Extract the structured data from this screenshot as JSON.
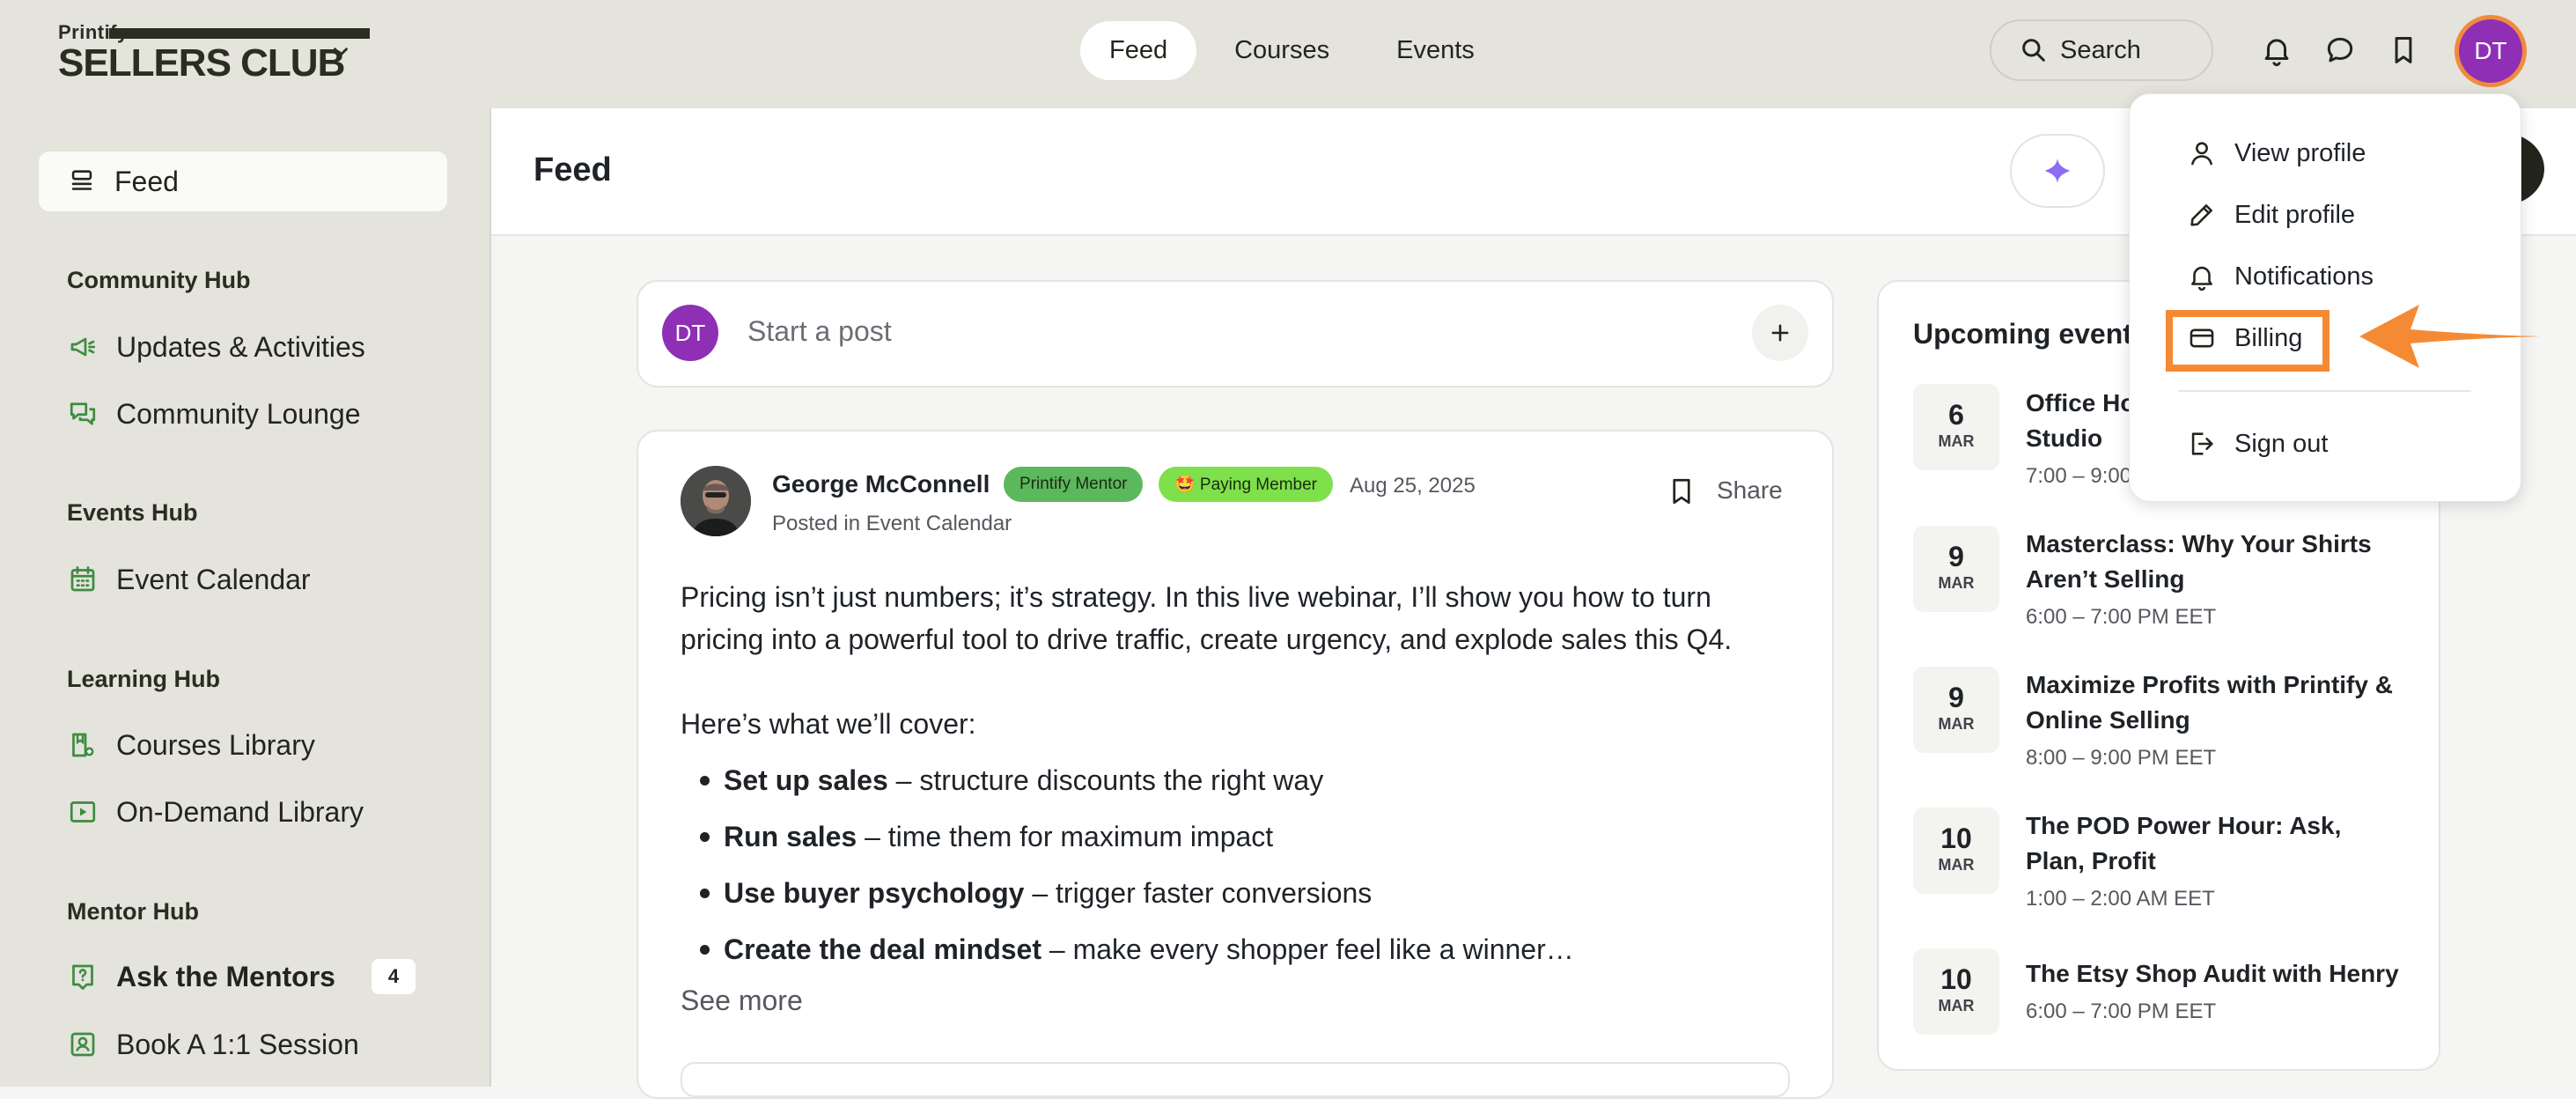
{
  "brand": {
    "small_text": "Printify",
    "big_text": "SELLERS CLUB"
  },
  "nav": {
    "tabs": [
      {
        "label": "Feed"
      },
      {
        "label": "Courses"
      },
      {
        "label": "Events"
      }
    ]
  },
  "search": {
    "label": "Search"
  },
  "user": {
    "initials": "DT"
  },
  "sidebar": {
    "feed_label": "Feed",
    "sections": [
      {
        "heading": "Community Hub",
        "items": [
          {
            "label": "Updates & Activities",
            "icon": "megaphone-icon"
          },
          {
            "label": "Community Lounge",
            "icon": "chat-bubbles-icon"
          }
        ]
      },
      {
        "heading": "Events Hub",
        "items": [
          {
            "label": "Event Calendar",
            "icon": "calendar-icon"
          }
        ]
      },
      {
        "heading": "Learning Hub",
        "items": [
          {
            "label": "Courses Library",
            "icon": "book-icon"
          },
          {
            "label": "On-Demand Library",
            "icon": "play-icon"
          }
        ]
      },
      {
        "heading": "Mentor Hub",
        "items": [
          {
            "label": "Ask the Mentors",
            "icon": "question-icon",
            "count": "4"
          },
          {
            "label": "Book A 1:1 Session",
            "icon": "person-badge-icon"
          }
        ]
      }
    ]
  },
  "main": {
    "title": "Feed"
  },
  "composer": {
    "placeholder": "Start a post"
  },
  "post": {
    "author": "George McConnell",
    "badge_mentor": "Printify Mentor",
    "badge_member": "🤩 Paying Member",
    "date": "Aug 25, 2025",
    "posted_in": "Posted in Event Calendar",
    "share_label": "Share",
    "paragraph": "Pricing isn’t just numbers; it’s strategy. In this live webinar, I’ll show you how to turn pricing into a powerful tool to drive traffic, create urgency, and explode sales this Q4.",
    "intro": "Here’s what we’ll cover:",
    "bullets": [
      {
        "bold": "Set up sales",
        "rest": " – structure discounts the right way"
      },
      {
        "bold": "Run sales",
        "rest": " – time them for maximum impact"
      },
      {
        "bold": "Use buyer psychology",
        "rest": " – trigger faster conversions"
      },
      {
        "bold": "Create the deal mindset",
        "rest": " – make every shopper feel like a winner…"
      }
    ],
    "see_more": "See more"
  },
  "events": {
    "title": "Upcoming event",
    "items": [
      {
        "day": "6",
        "month": "MAR",
        "title": "Office Ho… Studio",
        "title_line1": "Office Ho",
        "title_line2": "Studio",
        "time": "7:00 – 9:00"
      },
      {
        "day": "9",
        "month": "MAR",
        "title_line1": "Masterclass: Why Your Shirts",
        "title_line2": "Aren’t Selling",
        "time": "6:00 – 7:00 PM EET"
      },
      {
        "day": "9",
        "month": "MAR",
        "title_line1": "Maximize Profits with Printify &",
        "title_line2": "Online Selling",
        "time": "8:00 – 9:00 PM EET"
      },
      {
        "day": "10",
        "month": "MAR",
        "title_line1": "The POD Power Hour: Ask,",
        "title_line2": "Plan, Profit",
        "time": "1:00 – 2:00 AM EET"
      },
      {
        "day": "10",
        "month": "MAR",
        "title_line1": "The Etsy Shop Audit with Henry",
        "title_line2": "",
        "time": "6:00 – 7:00 PM EET"
      }
    ]
  },
  "dropdown": {
    "items": [
      {
        "label": "View profile",
        "icon": "user-icon"
      },
      {
        "label": "Edit profile",
        "icon": "pencil-icon"
      },
      {
        "label": "Notifications",
        "icon": "bell-icon"
      },
      {
        "label": "Billing",
        "icon": "credit-card-icon"
      },
      {
        "label": "Sign out",
        "icon": "sign-out-icon"
      }
    ]
  },
  "colors": {
    "accent_orange": "#f58a35",
    "avatar_purple": "#8e2fb6",
    "mentor_badge": "#5cb85c",
    "member_badge": "#7ee04a",
    "topbar_bg": "#e4e3dc"
  }
}
